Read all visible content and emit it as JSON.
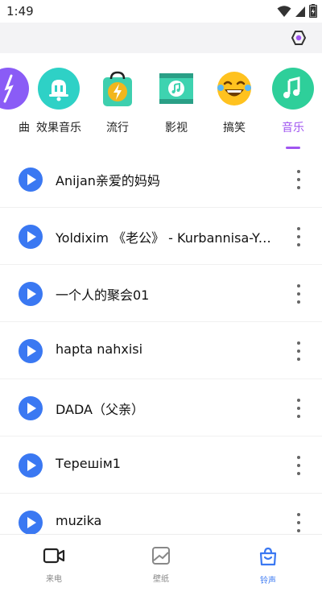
{
  "status_bar": {
    "time": "1:49"
  },
  "categories": [
    {
      "label": "曲",
      "icon": "feather-icon",
      "color": "#8a5cf6"
    },
    {
      "label": "效果音乐",
      "icon": "bell-icon",
      "color": "#2ed1c6"
    },
    {
      "label": "流行",
      "icon": "lightning-bag-icon",
      "color": "#f2b61d"
    },
    {
      "label": "影视",
      "icon": "film-music-icon",
      "color": "#3ed3b0"
    },
    {
      "label": "搞笑",
      "icon": "laughing-face-icon",
      "color": "#ffc21f"
    },
    {
      "label": "音乐",
      "icon": "music-note-icon",
      "color": "#2ecf9a",
      "active": true
    }
  ],
  "songs": [
    {
      "title": "Anijan亲爱的妈妈"
    },
    {
      "title": "Yoldixim 《老公》 - Kurbannisa-Yolwas"
    },
    {
      "title": "一个人的聚会01"
    },
    {
      "title": "hapta nahxisi"
    },
    {
      "title": "DADA（父亲）"
    },
    {
      "title": "Терешім1"
    },
    {
      "title": "muzika"
    }
  ],
  "bottom_nav": [
    {
      "label": "来电",
      "icon": "video-camera-icon"
    },
    {
      "label": "壁纸",
      "icon": "wallpaper-icon"
    },
    {
      "label": "铃声",
      "icon": "shopping-bag-icon",
      "active": true
    }
  ],
  "colors": {
    "accent_purple": "#a055f0",
    "play_blue": "#3a78f2"
  }
}
